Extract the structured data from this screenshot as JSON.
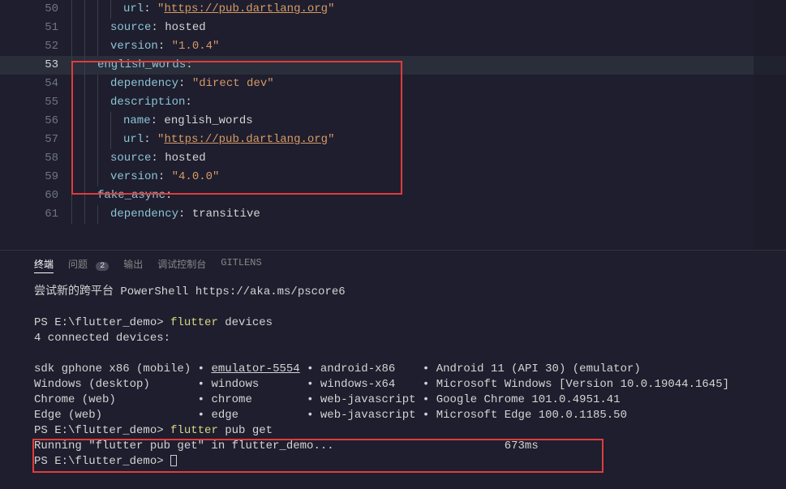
{
  "editor": {
    "lines": [
      {
        "num": "50",
        "indents": 4,
        "tokens": [
          {
            "t": "prop",
            "v": "url"
          },
          {
            "t": "plain",
            "v": ": "
          },
          {
            "t": "str",
            "v": "\""
          },
          {
            "t": "link",
            "v": "https://pub.dartlang.org"
          },
          {
            "t": "str",
            "v": "\""
          }
        ]
      },
      {
        "num": "51",
        "indents": 3,
        "tokens": [
          {
            "t": "prop",
            "v": "source"
          },
          {
            "t": "plain",
            "v": ": hosted"
          }
        ]
      },
      {
        "num": "52",
        "indents": 3,
        "tokens": [
          {
            "t": "prop",
            "v": "version"
          },
          {
            "t": "plain",
            "v": ": "
          },
          {
            "t": "str",
            "v": "\"1.0.4\""
          }
        ]
      },
      {
        "num": "53",
        "indents": 2,
        "active": true,
        "tokens": [
          {
            "t": "prop",
            "v": "english_words"
          },
          {
            "t": "plain",
            "v": ":"
          }
        ]
      },
      {
        "num": "54",
        "indents": 3,
        "tokens": [
          {
            "t": "prop",
            "v": "dependency"
          },
          {
            "t": "plain",
            "v": ": "
          },
          {
            "t": "str",
            "v": "\"direct dev\""
          }
        ]
      },
      {
        "num": "55",
        "indents": 3,
        "tokens": [
          {
            "t": "prop",
            "v": "description"
          },
          {
            "t": "plain",
            "v": ":"
          }
        ]
      },
      {
        "num": "56",
        "indents": 4,
        "tokens": [
          {
            "t": "prop",
            "v": "name"
          },
          {
            "t": "plain",
            "v": ": english_words"
          }
        ]
      },
      {
        "num": "57",
        "indents": 4,
        "tokens": [
          {
            "t": "prop",
            "v": "url"
          },
          {
            "t": "plain",
            "v": ": "
          },
          {
            "t": "str",
            "v": "\""
          },
          {
            "t": "link",
            "v": "https://pub.dartlang.org"
          },
          {
            "t": "str",
            "v": "\""
          }
        ]
      },
      {
        "num": "58",
        "indents": 3,
        "tokens": [
          {
            "t": "prop",
            "v": "source"
          },
          {
            "t": "plain",
            "v": ": hosted"
          }
        ]
      },
      {
        "num": "59",
        "indents": 3,
        "tokens": [
          {
            "t": "prop",
            "v": "version"
          },
          {
            "t": "plain",
            "v": ": "
          },
          {
            "t": "str",
            "v": "\"4.0.0\""
          }
        ]
      },
      {
        "num": "60",
        "indents": 2,
        "tokens": [
          {
            "t": "prop",
            "v": "fake_async"
          },
          {
            "t": "plain",
            "v": ":"
          }
        ]
      },
      {
        "num": "61",
        "indents": 3,
        "tokens": [
          {
            "t": "prop",
            "v": "dependency"
          },
          {
            "t": "plain",
            "v": ": transitive"
          }
        ]
      }
    ]
  },
  "panel": {
    "tabs": {
      "terminal": "终端",
      "problems": "问题",
      "problems_count": "2",
      "output": "输出",
      "debug": "调试控制台",
      "gitlens": "GITLENS"
    }
  },
  "terminal": {
    "banner": "尝试新的跨平台 PowerShell https://aka.ms/pscore6",
    "prompt1_path": "PS E:\\flutter_demo> ",
    "cmd1": "flutter",
    "cmd1_args": " devices",
    "devices_header": "4 connected devices:",
    "dev_rows": [
      {
        "c1": "sdk gphone x86 (mobile)",
        "c2": "emulator-5554",
        "c3": "android-x86   ",
        "c4": "Android 11 (API 30) (emulator)",
        "link2": true
      },
      {
        "c1": "Windows (desktop)      ",
        "c2": "windows      ",
        "c3": "windows-x64   ",
        "c4": "Microsoft Windows [Version 10.0.19044.1645]"
      },
      {
        "c1": "Chrome (web)           ",
        "c2": "chrome       ",
        "c3": "web-javascript",
        "c4": "Google Chrome 101.0.4951.41"
      },
      {
        "c1": "Edge (web)             ",
        "c2": "edge         ",
        "c3": "web-javascript",
        "c4": "Microsoft Edge 100.0.1185.50"
      }
    ],
    "prompt2_path": "PS E:\\flutter_demo> ",
    "cmd2": "flutter",
    "cmd2_args": " pub get",
    "running": "Running \"flutter pub get\" in flutter_demo...",
    "running_time": "673ms",
    "prompt3_path": "PS E:\\flutter_demo> "
  }
}
